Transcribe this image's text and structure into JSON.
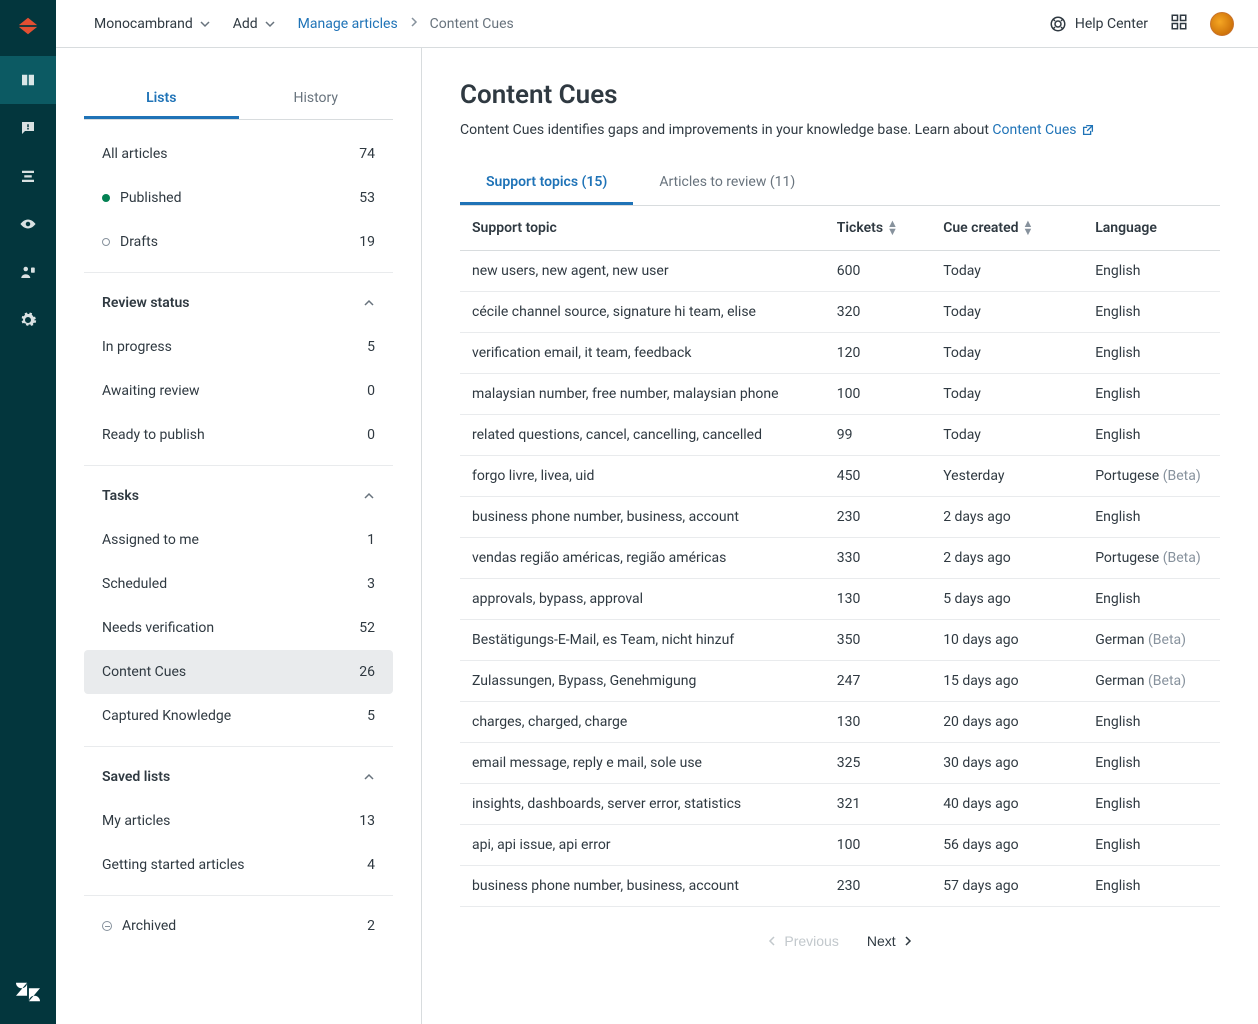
{
  "topbar": {
    "workspace": "Monocambrand",
    "add": "Add",
    "crumb_link": "Manage articles",
    "crumb_current": "Content Cues",
    "help": "Help Center"
  },
  "sidebar": {
    "tab_lists": "Lists",
    "tab_history": "History",
    "all_label": "All articles",
    "all_count": "74",
    "published_label": "Published",
    "published_count": "53",
    "drafts_label": "Drafts",
    "drafts_count": "19",
    "review_head": "Review status",
    "review": [
      {
        "label": "In progress",
        "count": "5"
      },
      {
        "label": "Awaiting review",
        "count": "0"
      },
      {
        "label": "Ready to publish",
        "count": "0"
      }
    ],
    "tasks_head": "Tasks",
    "tasks": [
      {
        "label": "Assigned to me",
        "count": "1"
      },
      {
        "label": "Scheduled",
        "count": "3"
      },
      {
        "label": "Needs verification",
        "count": "52"
      },
      {
        "label": "Content Cues",
        "count": "26"
      },
      {
        "label": "Captured Knowledge",
        "count": "5"
      }
    ],
    "saved_head": "Saved lists",
    "saved": [
      {
        "label": "My articles",
        "count": "13"
      },
      {
        "label": "Getting started articles",
        "count": "4"
      }
    ],
    "archived_label": "Archived",
    "archived_count": "2"
  },
  "content": {
    "title": "Content Cues",
    "subtext_pre": "Content Cues identifies gaps and improvements in your knowledge base. Learn about ",
    "subtext_link": "Content Cues",
    "tab_topics_pre": "Support topics",
    "tab_topics_count": "(15)",
    "tab_review_pre": "Articles to review",
    "tab_review_count": "(11)",
    "col_topic": "Support topic",
    "col_tickets": "Tickets",
    "col_created": "Cue created",
    "col_lang": "Language",
    "beta": "(Beta)",
    "rows": [
      {
        "topic": "new users, new agent, new user",
        "tickets": "600",
        "created": "Today",
        "lang": "English",
        "beta": false
      },
      {
        "topic": "cécile channel source, signature hi team, elise",
        "tickets": "320",
        "created": "Today",
        "lang": "English",
        "beta": false
      },
      {
        "topic": "verification email, it team, feedback",
        "tickets": "120",
        "created": "Today",
        "lang": "English",
        "beta": false
      },
      {
        "topic": "malaysian number, free number, malaysian phone",
        "tickets": "100",
        "created": "Today",
        "lang": "English",
        "beta": false
      },
      {
        "topic": "related questions, cancel, cancelling, cancelled",
        "tickets": "99",
        "created": "Today",
        "lang": "English",
        "beta": false
      },
      {
        "topic": "forgo livre, livea, uid",
        "tickets": "450",
        "created": "Yesterday",
        "lang": "Portugese",
        "beta": true
      },
      {
        "topic": "business phone number, business, account",
        "tickets": "230",
        "created": "2 days ago",
        "lang": "English",
        "beta": false
      },
      {
        "topic": "vendas região américas, região américas",
        "tickets": "330",
        "created": "2 days ago",
        "lang": "Portugese",
        "beta": true
      },
      {
        "topic": "approvals, bypass, approval",
        "tickets": "130",
        "created": "5 days ago",
        "lang": "English",
        "beta": false
      },
      {
        "topic": "Bestätigungs-E-Mail, es Team, nicht hinzuf",
        "tickets": "350",
        "created": "10 days ago",
        "lang": "German",
        "beta": true
      },
      {
        "topic": "Zulassungen, Bypass, Genehmigung",
        "tickets": "247",
        "created": "15 days ago",
        "lang": "German",
        "beta": true
      },
      {
        "topic": "charges, charged, charge",
        "tickets": "130",
        "created": "20 days ago",
        "lang": "English",
        "beta": false
      },
      {
        "topic": "email message, reply e mail, sole use",
        "tickets": "325",
        "created": "30 days ago",
        "lang": "English",
        "beta": false
      },
      {
        "topic": "insights, dashboards, server error, statistics",
        "tickets": "321",
        "created": "40 days ago",
        "lang": "English",
        "beta": false
      },
      {
        "topic": "api, api issue, api error",
        "tickets": "100",
        "created": "56 days ago",
        "lang": "English",
        "beta": false
      },
      {
        "topic": "business phone number, business, account",
        "tickets": "230",
        "created": "57 days ago",
        "lang": "English",
        "beta": false
      }
    ],
    "prev": "Previous",
    "next": "Next"
  }
}
